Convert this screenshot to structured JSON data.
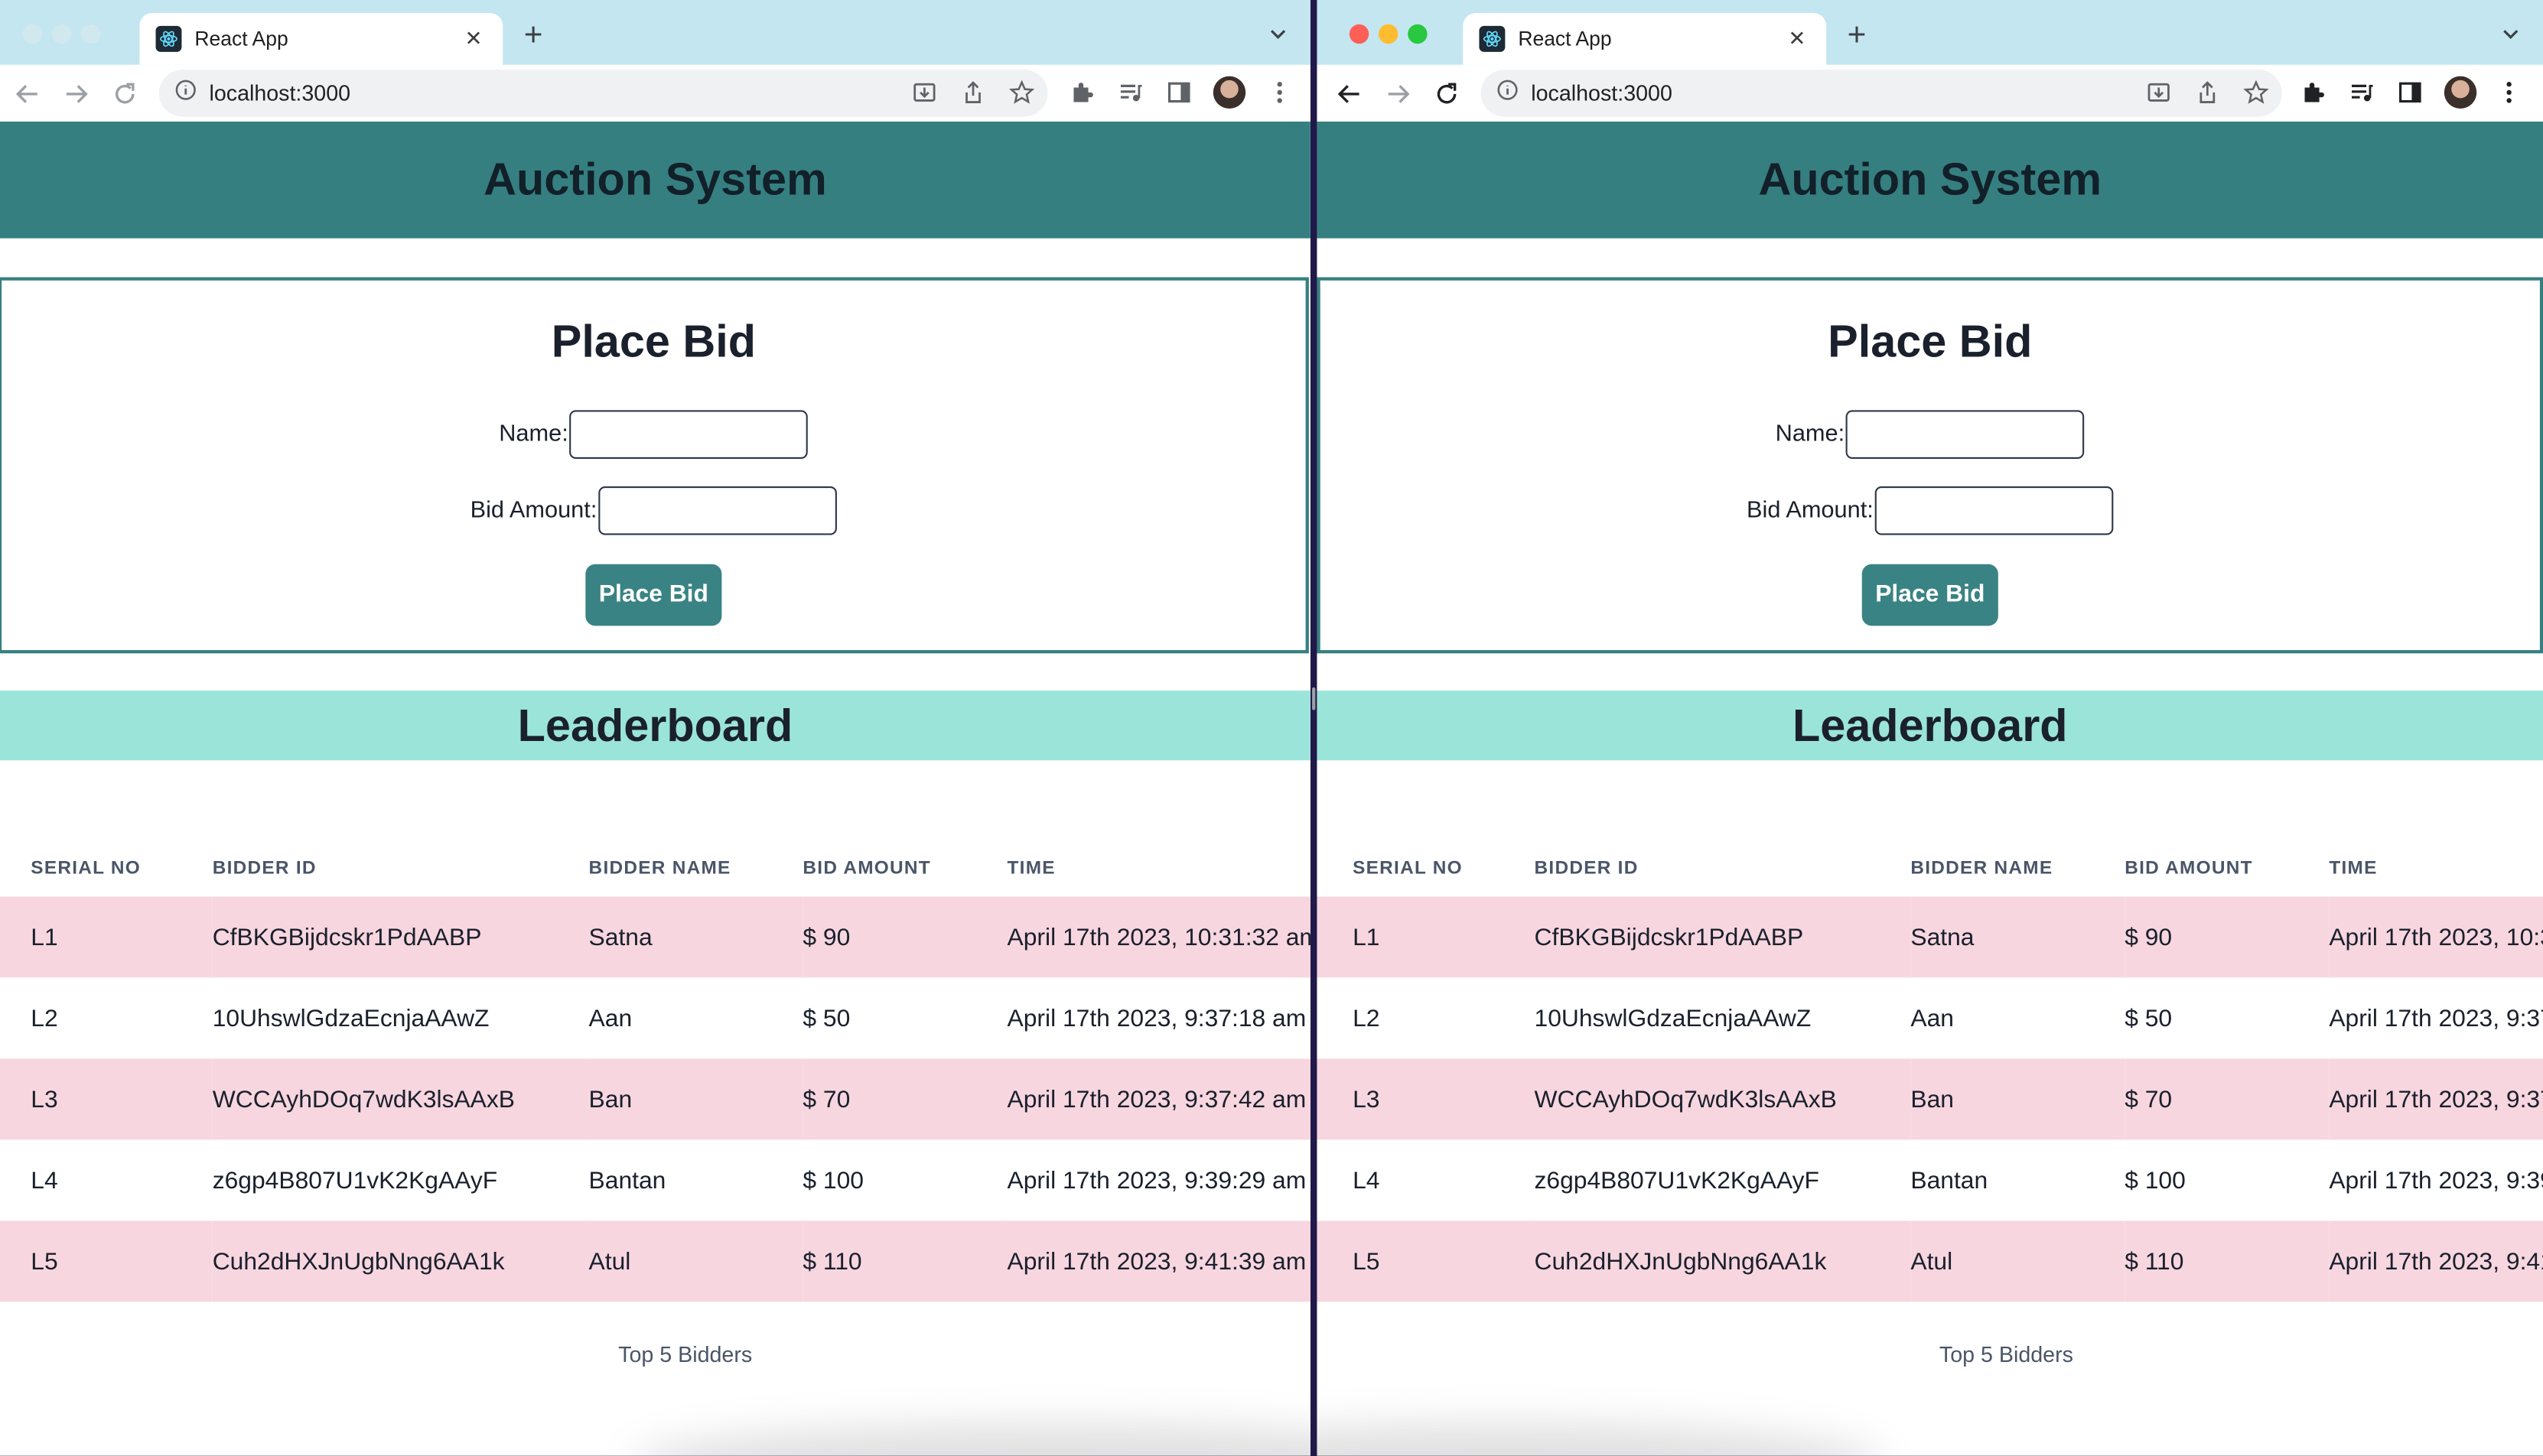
{
  "browser": {
    "tab_title": "React App",
    "tab_close": "✕",
    "new_tab": "+",
    "url": "localhost:3000"
  },
  "app": {
    "title": "Auction System",
    "bid_form": {
      "heading": "Place Bid",
      "name_label": "Name:",
      "name_value": "",
      "amount_label": "Bid Amount:",
      "amount_value": "",
      "submit_label": "Place Bid"
    },
    "leaderboard": {
      "title": "Leaderboard",
      "columns": [
        "SERIAL NO",
        "BIDDER ID",
        "BIDDER NAME",
        "BID AMOUNT",
        "TIME"
      ],
      "rows": [
        [
          "L1",
          "CfBKGBijdcskr1PdAABP",
          "Satna",
          "$ 90",
          "April 17th 2023, 10:31:32 am"
        ],
        [
          "L2",
          "10UhswlGdzaEcnjaAAwZ",
          "Aan",
          "$ 50",
          "April 17th 2023, 9:37:18 am"
        ],
        [
          "L3",
          "WCCAyhDOq7wdK3lsAAxB",
          "Ban",
          "$ 70",
          "April 17th 2023, 9:37:42 am"
        ],
        [
          "L4",
          "z6gp4B807U1vK2KgAAyF",
          "Bantan",
          "$ 100",
          "April 17th 2023, 9:39:29 am"
        ],
        [
          "L5",
          "Cuh2dHXJnUgbNng6AA1k",
          "Atul",
          "$ 110",
          "April 17th 2023, 9:41:39 am"
        ]
      ],
      "caption": "Top 5 Bidders"
    }
  }
}
